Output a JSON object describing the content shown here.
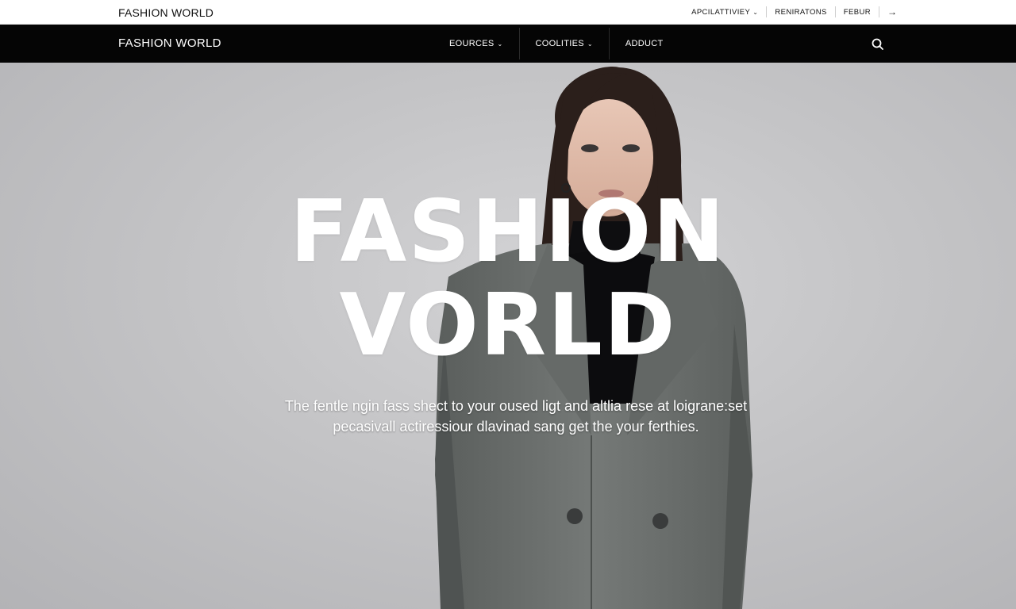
{
  "utility_bar": {
    "brand": "FASHION WORLD",
    "links": [
      {
        "label": "APCILATTIVIEY",
        "caret": "⌄"
      },
      {
        "label": "RENIRATONS"
      },
      {
        "label": "FEBUR"
      }
    ],
    "arrow": "→"
  },
  "main_nav": {
    "brand": "FASHION WORLD",
    "items": [
      {
        "label": "EOURCES",
        "caret": "⌄"
      },
      {
        "label": "COOLITIES",
        "caret": "⌄"
      },
      {
        "label": "ADDUCT"
      }
    ],
    "search_icon": "search-icon"
  },
  "hero": {
    "title_line1": "FASHION",
    "title_line2": "VORLD",
    "subtitle_line1": "The fentle ngin fass shect to your oused ligt and altlia rese at loigrane:set",
    "subtitle_line2": "pecasivall actiressiour dlavinad sang get the your ferthies."
  },
  "colors": {
    "nav_background": "#050505",
    "hero_background": "#c4c4c6",
    "coat": "#6d716f",
    "hero_text": "#ffffff"
  }
}
